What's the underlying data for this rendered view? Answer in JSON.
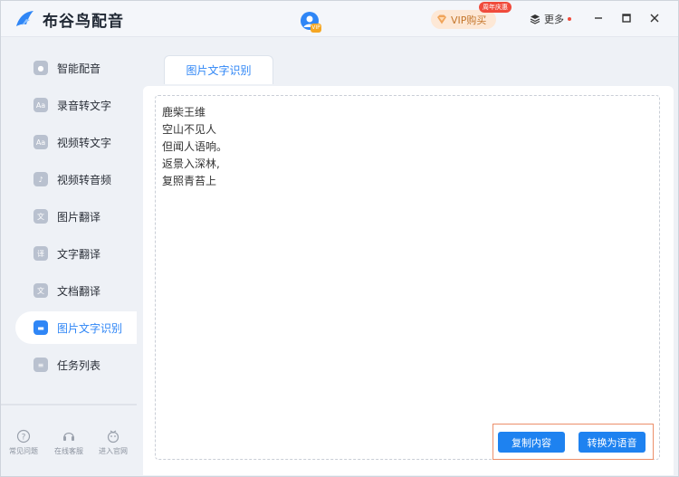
{
  "app": {
    "title": "布谷鸟配音"
  },
  "header": {
    "avatar_badge": "VIP",
    "vip_button": "VIP购买",
    "vip_tag": "周年庆惠",
    "more_label": "更多",
    "accent": "#2f86f6"
  },
  "sidebar": {
    "items": [
      {
        "label": "智能配音",
        "icon": "microphone-icon"
      },
      {
        "label": "录音转文字",
        "icon": "audio-text-icon"
      },
      {
        "label": "视频转文字",
        "icon": "video-text-icon"
      },
      {
        "label": "视频转音频",
        "icon": "video-audio-icon"
      },
      {
        "label": "图片翻译",
        "icon": "image-translate-icon"
      },
      {
        "label": "文字翻译",
        "icon": "text-translate-icon"
      },
      {
        "label": "文档翻译",
        "icon": "doc-translate-icon"
      },
      {
        "label": "图片文字识别",
        "icon": "image-ocr-icon",
        "active": true
      },
      {
        "label": "任务列表",
        "icon": "task-list-icon"
      }
    ],
    "footer": [
      {
        "label": "常见问题",
        "icon": "question-icon"
      },
      {
        "label": "在线客服",
        "icon": "headset-icon"
      },
      {
        "label": "进入官网",
        "icon": "website-icon"
      }
    ]
  },
  "main": {
    "tab_label": "图片文字识别",
    "text_lines": [
      "鹿柴王维",
      "空山不见人",
      "但闻人语响。",
      "返景入深林,",
      "复照青苔上"
    ],
    "copy_button": "复制内容",
    "speech_button": "转换为语音"
  }
}
